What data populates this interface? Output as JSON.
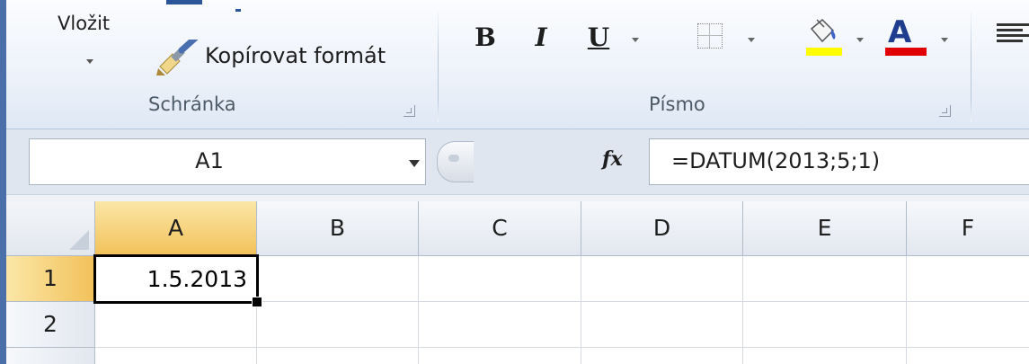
{
  "ribbon": {
    "clipboard": {
      "paste_label": "Vložit",
      "format_painter_label": "Kopírovat formát",
      "group_label": "Schránka"
    },
    "font": {
      "bold_label": "B",
      "italic_label": "I",
      "underline_label": "U",
      "font_color_letter": "A",
      "group_label": "Písmo",
      "fill_color": "#ffff00",
      "font_color": "#e00000"
    }
  },
  "formula_bar": {
    "name_box_value": "A1",
    "fx_label": "fx",
    "formula": "=DATUM(2013;5;1)"
  },
  "sheet": {
    "columns": [
      "A",
      "B",
      "C",
      "D",
      "E",
      "F"
    ],
    "rows": [
      "1",
      "2"
    ],
    "active_cell": "A1",
    "cells": {
      "A1": "1.5.2013"
    }
  }
}
